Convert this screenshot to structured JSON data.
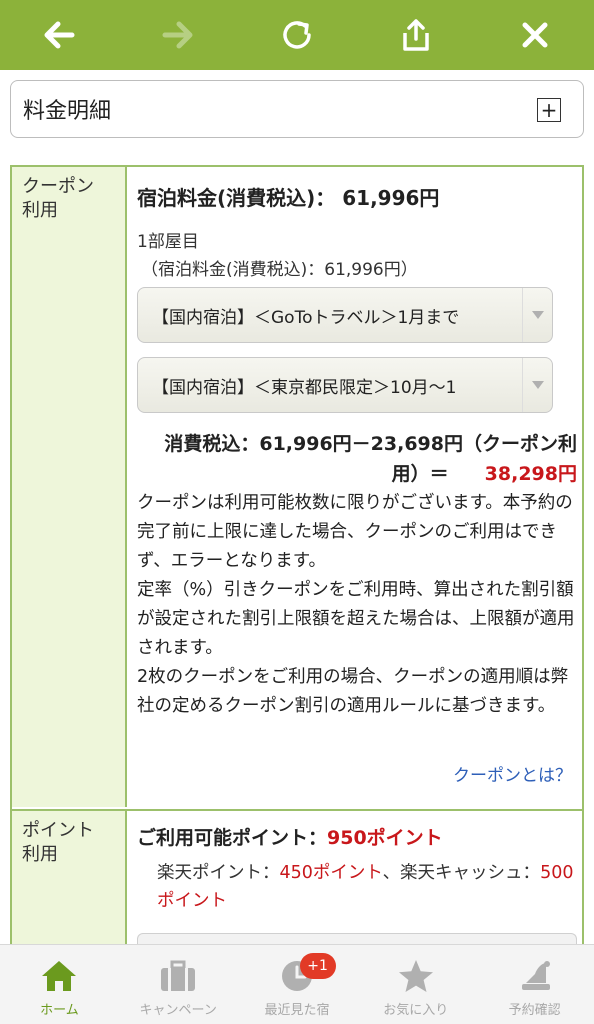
{
  "topbar": {
    "back_icon": "arrow-left-icon",
    "forward_icon": "arrow-right-icon",
    "reload_icon": "reload-icon",
    "share_icon": "share-icon",
    "close_icon": "close-icon"
  },
  "detail_header": {
    "title": "料金明細",
    "expand_symbol": "+"
  },
  "coupon_section": {
    "label": "クーポン\n利用",
    "fee_line": "宿泊料金(消費税込)： 61,996円",
    "room_label": "1部屋目",
    "room_fee": "（宿泊料金(消費税込)：61,996円）",
    "select1": "【国内宿泊】＜GoToトラベル＞1月まで",
    "select2": "【国内宿泊】＜東京都民限定＞10月～1",
    "calc_text": "消費税込：61,996円－23,698円（クーポン利用）＝",
    "calc_total": "38,298円",
    "notice": "クーポンは利用可能枚数に限りがございます。本予約の完了前に上限に達した場合、クーポンのご利用はできず、エラーとなります。\n定率（%）引きクーポンをご利用時、算出された割引額が設定された割引上限額を超えた場合は、上限額が適用されます。\n2枚のクーポンをご利用の場合、クーポンの適用順は弊社の定めるクーポン割引の適用ルールに基づきます。",
    "link": "クーポンとは？"
  },
  "point_section": {
    "label": "ポイント\n利用",
    "available_label": "ご利用可能ポイント：",
    "available_value": "950ポイント",
    "rakuten_point_label": "楽天ポイント：",
    "rakuten_point_value": "450ポイント",
    "rakuten_cash_label": "、楽天キャッシュ：",
    "rakuten_cash_value": "500ポイント"
  },
  "tabbar": {
    "tabs": [
      {
        "label": "ホーム",
        "icon": "home-icon"
      },
      {
        "label": "キャンペーン",
        "icon": "suitcase-icon"
      },
      {
        "label": "最近見た宿",
        "icon": "clock-icon",
        "badge": "+1"
      },
      {
        "label": "お気に入り",
        "icon": "star-icon"
      },
      {
        "label": "予約確認",
        "icon": "bell-icon"
      }
    ]
  },
  "colors": {
    "brand_green": "#8cb23a",
    "accent_red": "#c8171b",
    "link_blue": "#2e5fb8"
  }
}
